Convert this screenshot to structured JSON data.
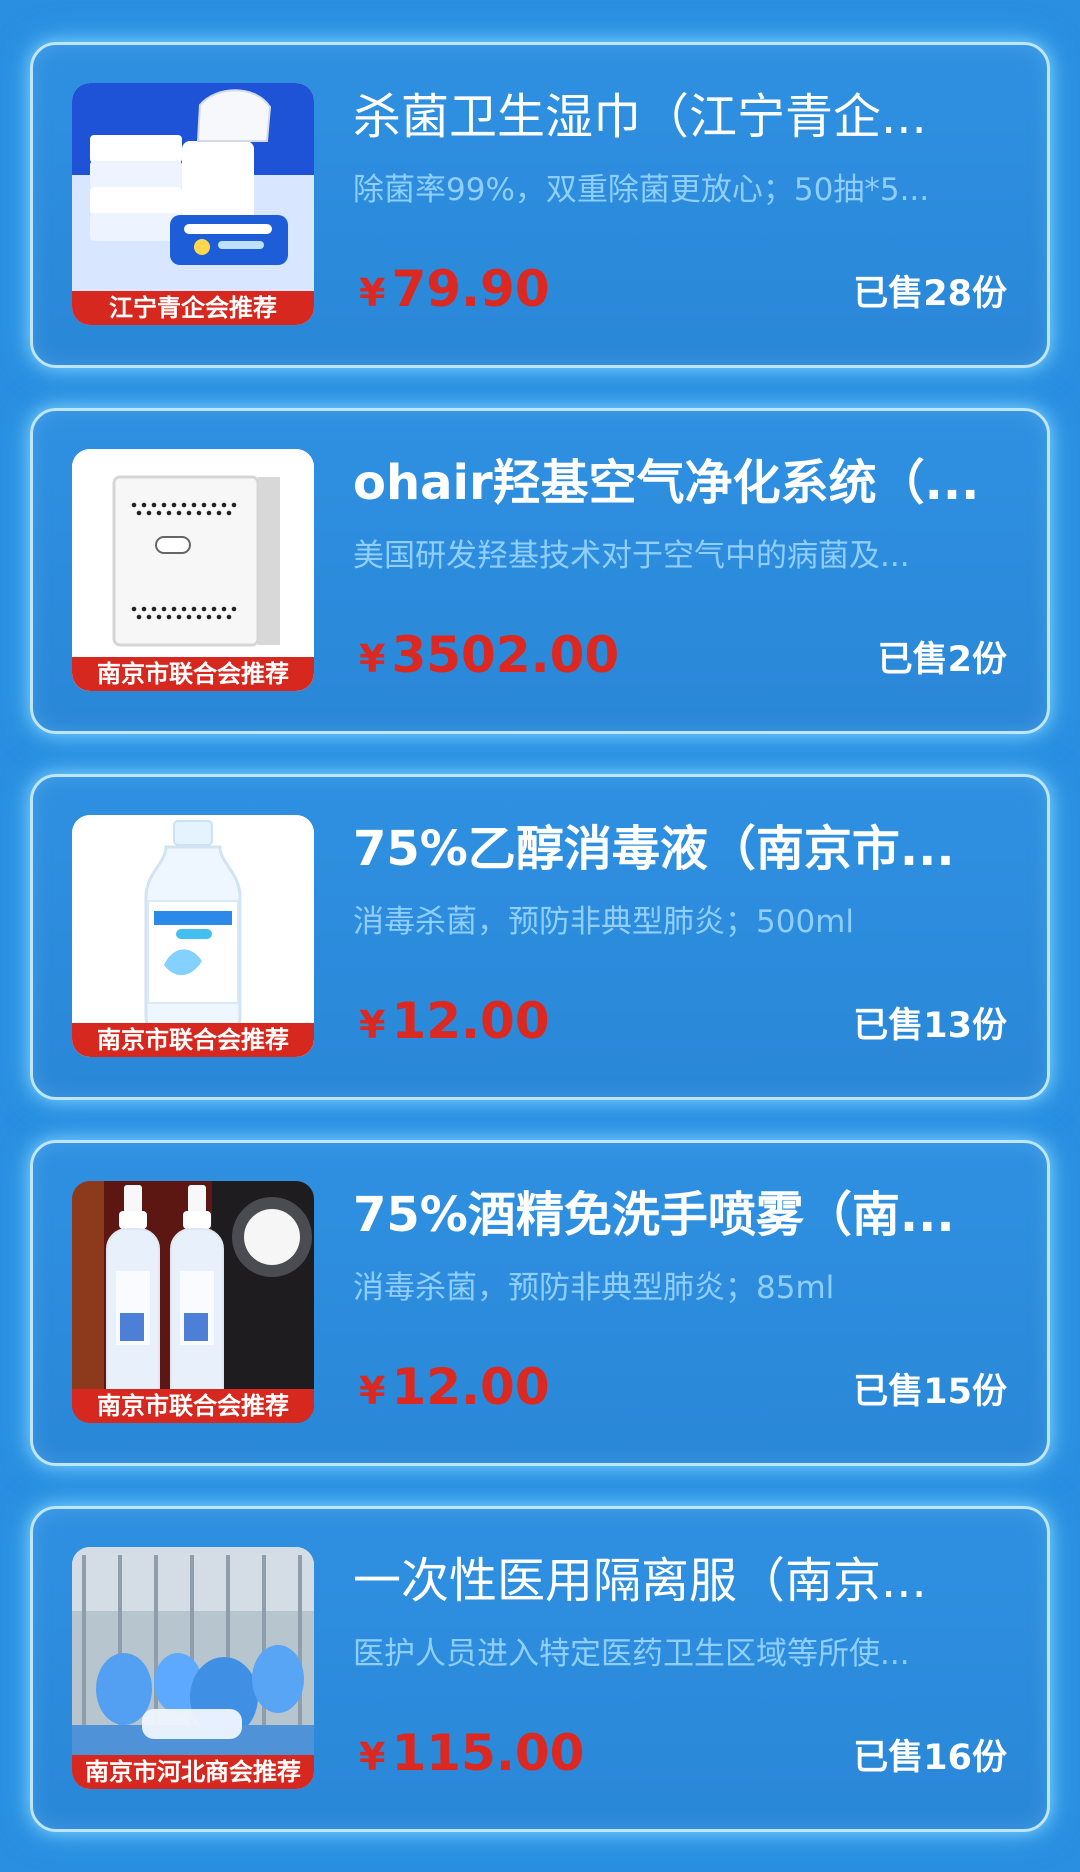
{
  "products": [
    {
      "title": "杀菌卫生湿巾（江宁青企...",
      "desc": "除菌率99%，双重除菌更放心；50抽*5...",
      "currency": "¥",
      "price": "79.90",
      "sold": "已售28份",
      "badge": "江宁青企会推荐"
    },
    {
      "title": "ohair羟基空气净化系统（...",
      "desc": "美国研发羟基技术对于空气中的病菌及...",
      "currency": "¥",
      "price": "3502.00",
      "sold": "已售2份",
      "badge": "南京市联合会推荐"
    },
    {
      "title": "75%乙醇消毒液（南京市...",
      "desc": "消毒杀菌，预防非典型肺炎；500ml",
      "currency": "¥",
      "price": "12.00",
      "sold": "已售13份",
      "badge": "南京市联合会推荐"
    },
    {
      "title": "75%酒精免洗手喷雾（南...",
      "desc": "消毒杀菌，预防非典型肺炎；85ml",
      "currency": "¥",
      "price": "12.00",
      "sold": "已售15份",
      "badge": "南京市联合会推荐"
    },
    {
      "title": "一次性医用隔离服（南京...",
      "desc": "医护人员进入特定医药卫生区域等所使...",
      "currency": "¥",
      "price": "115.00",
      "sold": "已售16份",
      "badge": "南京市河北商会推荐"
    }
  ]
}
